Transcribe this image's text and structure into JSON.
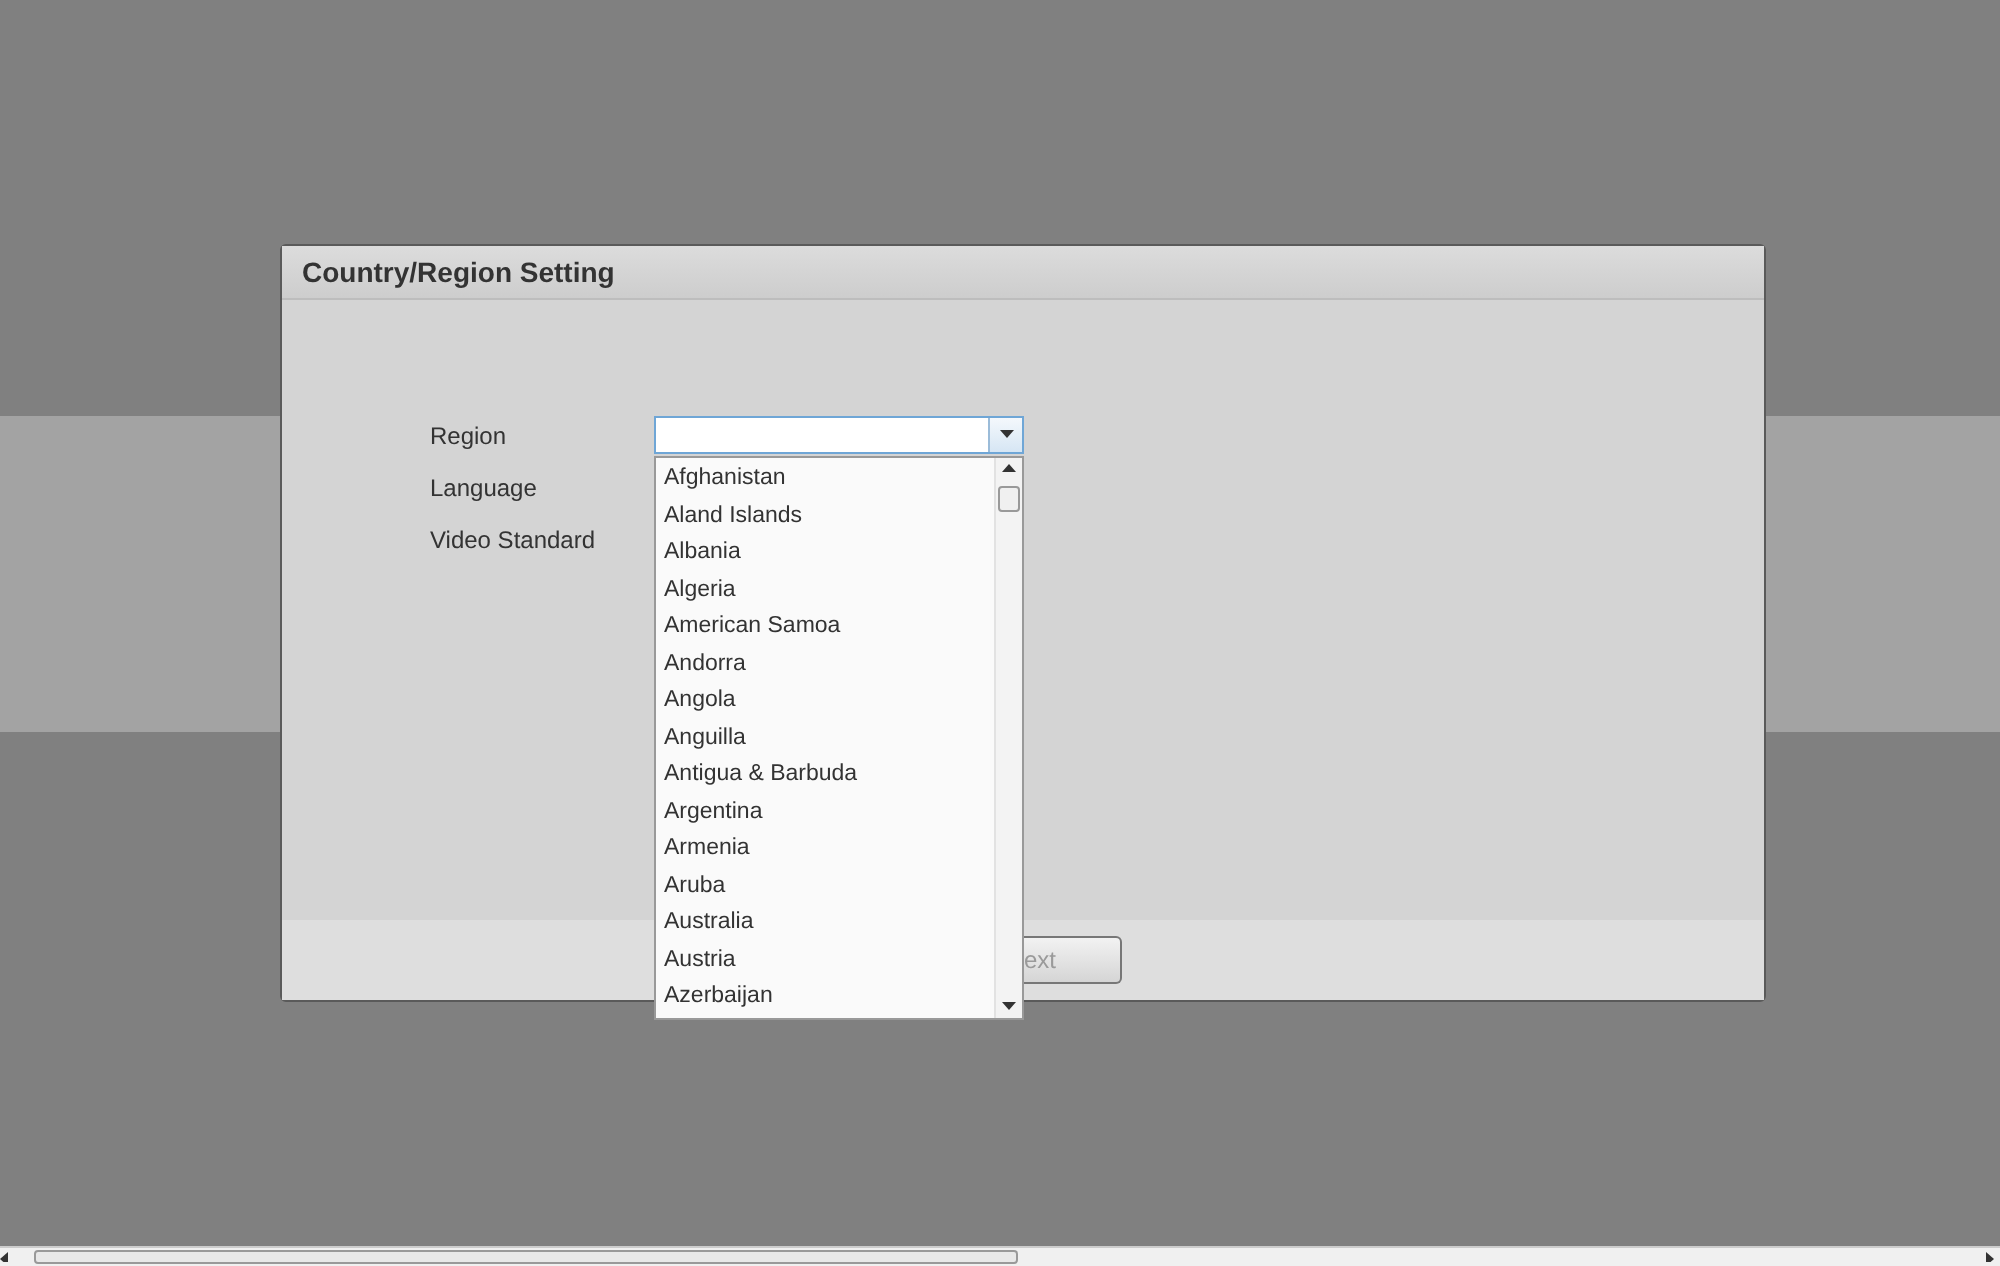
{
  "dialog": {
    "title": "Country/Region Setting"
  },
  "fields": [
    {
      "label": "Region",
      "kind": "select",
      "expanded": true
    },
    {
      "label": "Language",
      "kind": "hidden"
    },
    {
      "label": "Video Standard",
      "kind": "hidden"
    }
  ],
  "region_options": [
    "Afghanistan",
    "Aland Islands",
    "Albania",
    "Algeria",
    "American Samoa",
    "Andorra",
    "Angola",
    "Anguilla",
    "Antigua & Barbuda",
    "Argentina",
    "Armenia",
    "Aruba",
    "Australia",
    "Austria",
    "Azerbaijan"
  ],
  "footer": {
    "next_button": "ext"
  }
}
